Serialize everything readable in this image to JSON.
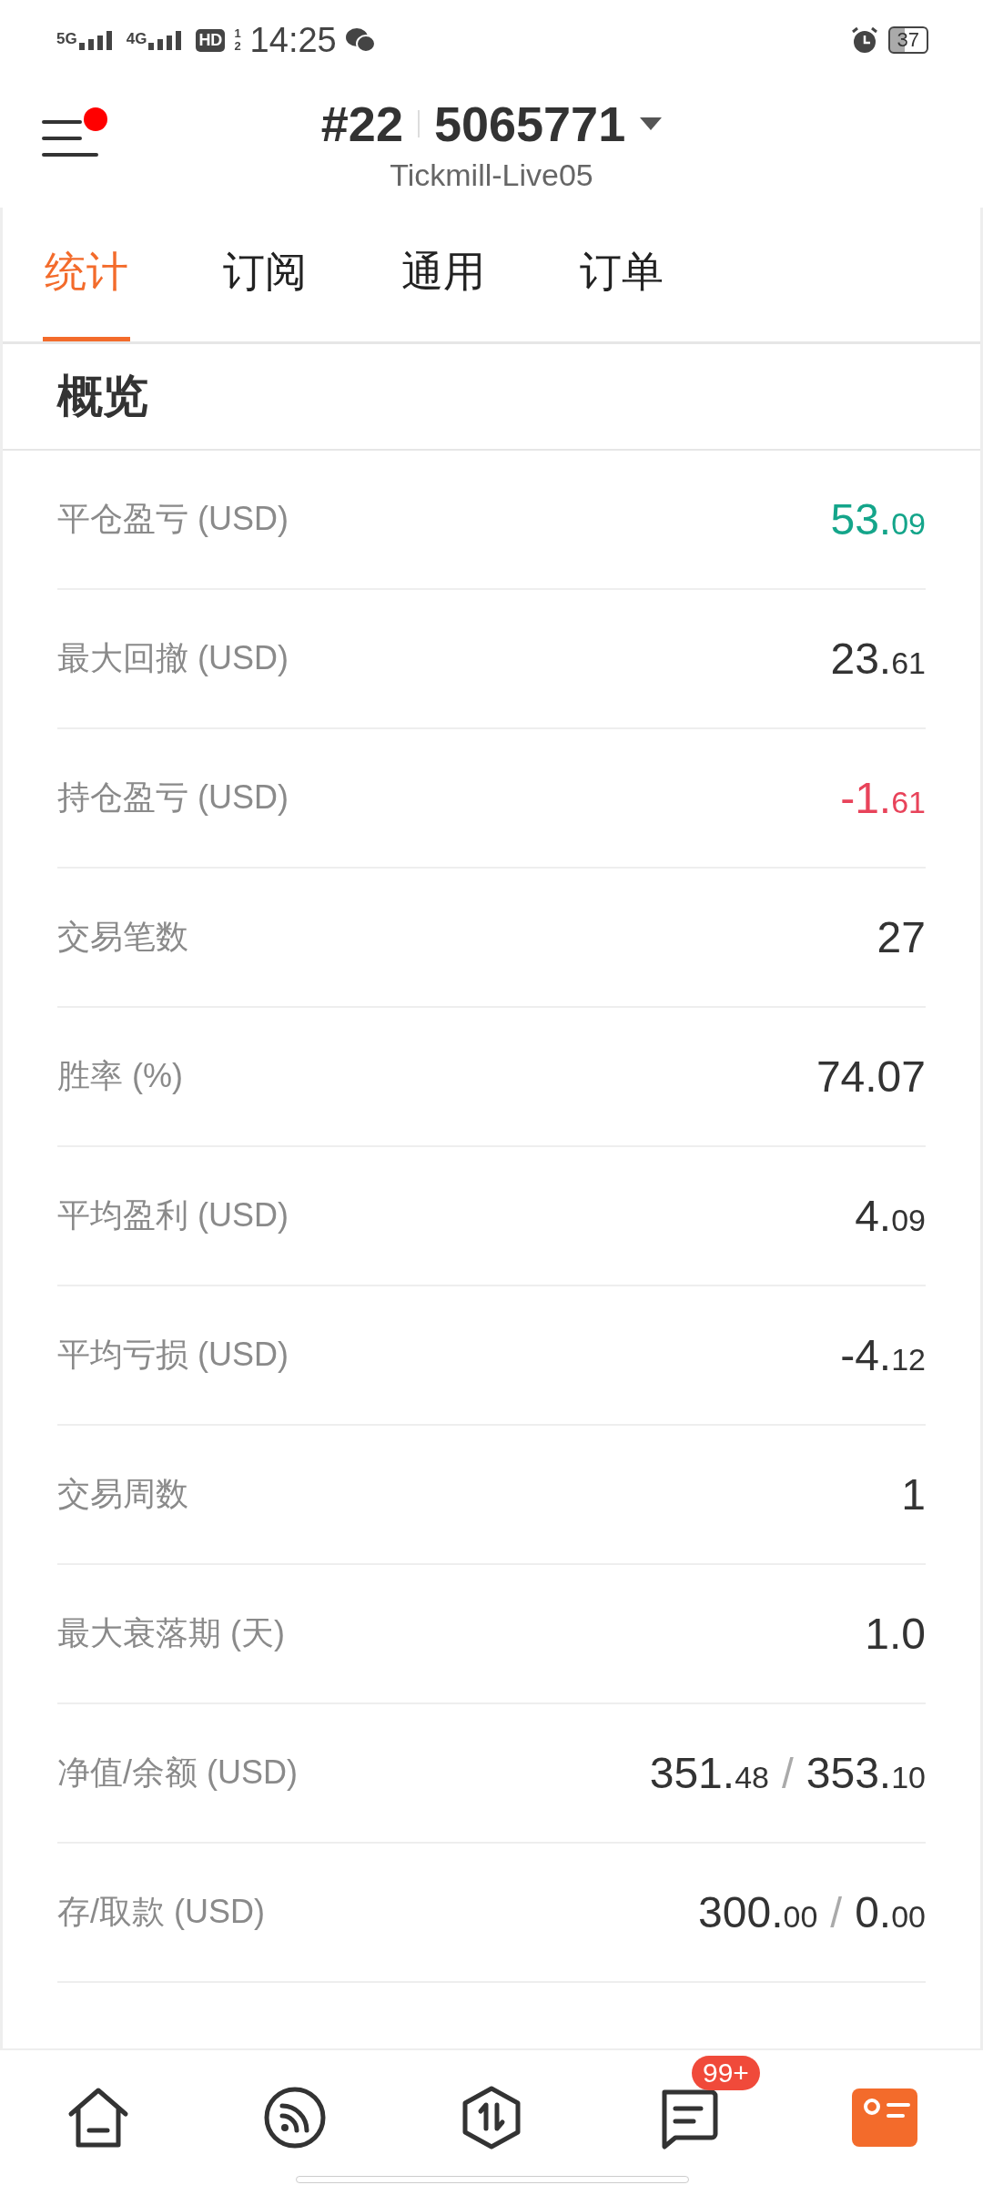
{
  "status_bar": {
    "network_1": "5G",
    "network_2": "4G",
    "hd_label": "HD",
    "hd_sims": [
      "1",
      "2"
    ],
    "time": "14:25",
    "battery": "37"
  },
  "header": {
    "has_notification": true,
    "account_prefix": "#22",
    "account_number": "5065771",
    "server": "Tickmill-Live05"
  },
  "tabs": [
    {
      "label": "统计",
      "selected": true
    },
    {
      "label": "订阅",
      "selected": false
    },
    {
      "label": "通用",
      "selected": false
    },
    {
      "label": "订单",
      "selected": false
    }
  ],
  "section_title": "概览",
  "rows": [
    {
      "label": "平仓盈亏 (USD)",
      "color": "#14a58a",
      "values": [
        {
          "main": "53.",
          "fraction": "09"
        }
      ]
    },
    {
      "label": "最大回撤 (USD)",
      "color": "#333333",
      "values": [
        {
          "main": "23.",
          "fraction": "61"
        }
      ]
    },
    {
      "label": "持仓盈亏 (USD)",
      "color": "#e8435a",
      "values": [
        {
          "main": "-1.",
          "fraction": "61"
        }
      ]
    },
    {
      "label": "交易笔数",
      "color": "#333333",
      "values": [
        {
          "main": "27"
        }
      ]
    },
    {
      "label": "胜率 (%)",
      "color": "#333333",
      "values": [
        {
          "main": "74.07"
        }
      ]
    },
    {
      "label": "平均盈利 (USD)",
      "color": "#333333",
      "values": [
        {
          "main": "4.",
          "fraction": "09"
        }
      ]
    },
    {
      "label": "平均亏损 (USD)",
      "color": "#333333",
      "values": [
        {
          "main": "-4.",
          "fraction": "12"
        }
      ]
    },
    {
      "label": "交易周数",
      "color": "#333333",
      "values": [
        {
          "main": "1"
        }
      ]
    },
    {
      "label": "最大衰落期 (天)",
      "color": "#333333",
      "values": [
        {
          "main": "1.0"
        }
      ]
    },
    {
      "label": "净值/余额 (USD)",
      "color": "#333333",
      "separator": "/",
      "values": [
        {
          "main": "351.",
          "fraction": "48"
        },
        {
          "main": "353.",
          "fraction": "10"
        }
      ]
    },
    {
      "label": "存/取款 (USD)",
      "color": "#333333",
      "separator": "/",
      "values": [
        {
          "main": "300.",
          "fraction": "00"
        },
        {
          "main": "0.",
          "fraction": "00"
        }
      ]
    }
  ],
  "bottom_nav": [
    {
      "kind": "home",
      "selected": false
    },
    {
      "kind": "feed",
      "selected": false
    },
    {
      "kind": "trade",
      "selected": false
    },
    {
      "kind": "messages",
      "selected": false,
      "badge": "99+"
    },
    {
      "kind": "profile",
      "selected": true
    }
  ]
}
